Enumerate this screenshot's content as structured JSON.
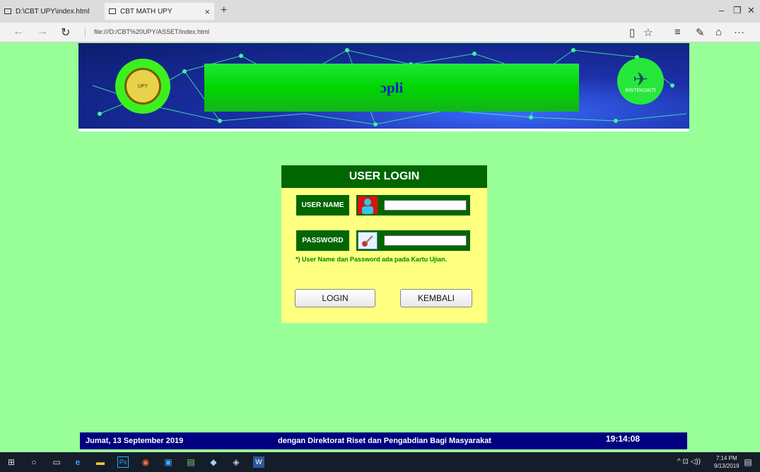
{
  "browser": {
    "tabs": [
      {
        "label": "D:\\CBT UPY\\index.html",
        "active": false
      },
      {
        "label": "CBT MATH UPY",
        "active": true
      }
    ],
    "new_tab": "+",
    "close_tab": "×",
    "window_controls": {
      "minimize": "–",
      "restore": "❐",
      "close": "✕"
    },
    "nav": {
      "back": "←",
      "forward": "→",
      "refresh": "↻"
    },
    "address": "file:///D:/CBT%20UPY/ASSET/index.html",
    "toolbar": {
      "reading_view": "▯",
      "favorites": "☆",
      "hub": "≡",
      "notes": "✎",
      "share": "⌂",
      "more": "···"
    }
  },
  "banner": {
    "title": "ɔpli",
    "left_logo_text": "UPY",
    "right_logo_mark": "✈",
    "right_logo_text": "RISTEKDIKTI"
  },
  "login": {
    "title": "USER LOGIN",
    "username_label": "USER NAME",
    "password_label": "PASSWORD",
    "username_value": "",
    "password_value": "",
    "note": "*)  User Name dan Password ada pada Kartu Ujian.",
    "login_button": "LOGIN",
    "back_button": "KEMBALI"
  },
  "footer": {
    "date": "Jumat, 13 September 2019",
    "marquee": "dengan Direktorat Riset dan Pengabdian Bagi Masyarakat",
    "clock": "19:14:08"
  },
  "taskbar": {
    "start": "⊞",
    "search": "○",
    "task_view": "▭",
    "apps": [
      "e",
      "▬",
      "Ps",
      "◉",
      "▣",
      "▤",
      "◆",
      "◈",
      "W"
    ],
    "tray_icons": "^ ⊡ ◁))",
    "time": "7:14 PM",
    "date": "9/13/2019",
    "notifications": "▤"
  }
}
